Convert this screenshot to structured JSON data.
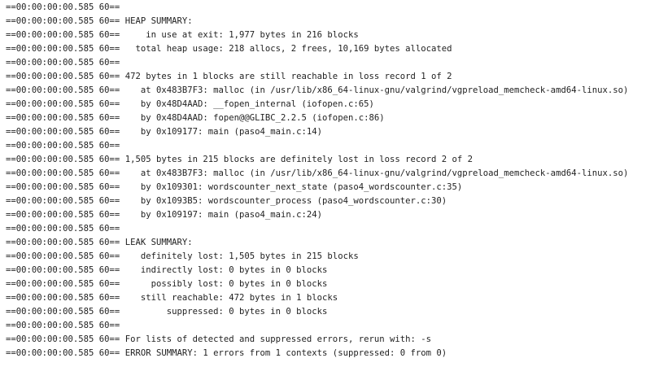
{
  "output": {
    "lines": [
      "==00:00:00:00.585 60==",
      "==00:00:00:00.585 60== HEAP SUMMARY:",
      "==00:00:00:00.585 60==     in use at exit: 1,977 bytes in 216 blocks",
      "==00:00:00:00.585 60==   total heap usage: 218 allocs, 2 frees, 10,169 bytes allocated",
      "==00:00:00:00.585 60==",
      "==00:00:00:00.585 60== 472 bytes in 1 blocks are still reachable in loss record 1 of 2",
      "==00:00:00:00.585 60==    at 0x483B7F3: malloc (in /usr/lib/x86_64-linux-gnu/valgrind/vgpreload_memcheck-amd64-linux.so)",
      "==00:00:00:00.585 60==    by 0x48D4AAD: __fopen_internal (iofopen.c:65)",
      "==00:00:00:00.585 60==    by 0x48D4AAD: fopen@@GLIBC_2.2.5 (iofopen.c:86)",
      "==00:00:00:00.585 60==    by 0x109177: main (paso4_main.c:14)",
      "==00:00:00:00.585 60==",
      "==00:00:00:00.585 60== 1,505 bytes in 215 blocks are definitely lost in loss record 2 of 2",
      "==00:00:00:00.585 60==    at 0x483B7F3: malloc (in /usr/lib/x86_64-linux-gnu/valgrind/vgpreload_memcheck-amd64-linux.so)",
      "==00:00:00:00.585 60==    by 0x109301: wordscounter_next_state (paso4_wordscounter.c:35)",
      "==00:00:00:00.585 60==    by 0x1093B5: wordscounter_process (paso4_wordscounter.c:30)",
      "==00:00:00:00.585 60==    by 0x109197: main (paso4_main.c:24)",
      "==00:00:00:00.585 60==",
      "==00:00:00:00.585 60== LEAK SUMMARY:",
      "==00:00:00:00.585 60==    definitely lost: 1,505 bytes in 215 blocks",
      "==00:00:00:00.585 60==    indirectly lost: 0 bytes in 0 blocks",
      "==00:00:00:00.585 60==      possibly lost: 0 bytes in 0 blocks",
      "==00:00:00:00.585 60==    still reachable: 472 bytes in 1 blocks",
      "==00:00:00:00.585 60==         suppressed: 0 bytes in 0 blocks",
      "==00:00:00:00.585 60==",
      "==00:00:00:00.585 60== For lists of detected and suppressed errors, rerun with: -s",
      "==00:00:00:00.585 60== ERROR SUMMARY: 1 errors from 1 contexts (suppressed: 0 from 0)"
    ]
  }
}
